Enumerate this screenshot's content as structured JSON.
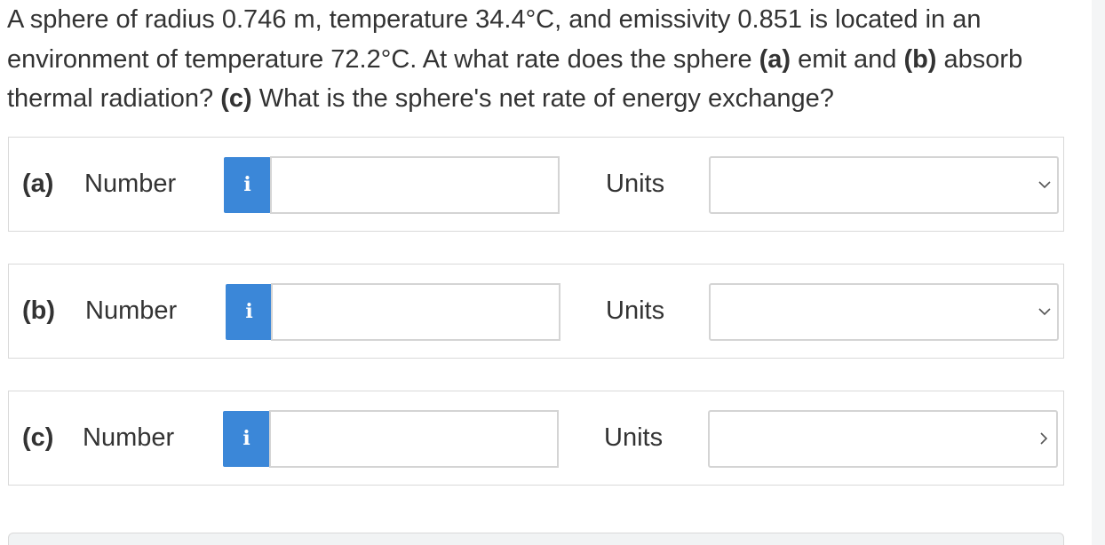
{
  "question": {
    "parts": [
      {
        "text": "A sphere of radius 0.746 m, temperature 34.4°C, and emissivity 0.851 is located in an environment of temperature 72.2°C. At what rate does the sphere ",
        "bold": false
      },
      {
        "text": "(a)",
        "bold": true
      },
      {
        "text": " emit and ",
        "bold": false
      },
      {
        "text": "(b)",
        "bold": true
      },
      {
        "text": " absorb thermal radiation? ",
        "bold": false
      },
      {
        "text": "(c)",
        "bold": true
      },
      {
        "text": " What is the sphere's net rate of energy exchange?",
        "bold": false
      }
    ]
  },
  "rows": [
    {
      "part_label": "(a)",
      "number_label": "Number",
      "info_icon": "info-icon",
      "info_glyph": "i",
      "number_value": "",
      "units_label": "Units",
      "units_value": ""
    },
    {
      "part_label": "(b)",
      "number_label": "Number",
      "info_icon": "info-icon",
      "info_glyph": "i",
      "number_value": "",
      "units_label": "Units",
      "units_value": ""
    },
    {
      "part_label": "(c)",
      "number_label": "Number",
      "info_icon": "info-icon",
      "info_glyph": "i",
      "number_value": "",
      "units_label": "Units",
      "units_value": ""
    }
  ],
  "colors": {
    "info_button": "#3b87d8",
    "text": "#333333",
    "border": "#d4d4d4"
  }
}
